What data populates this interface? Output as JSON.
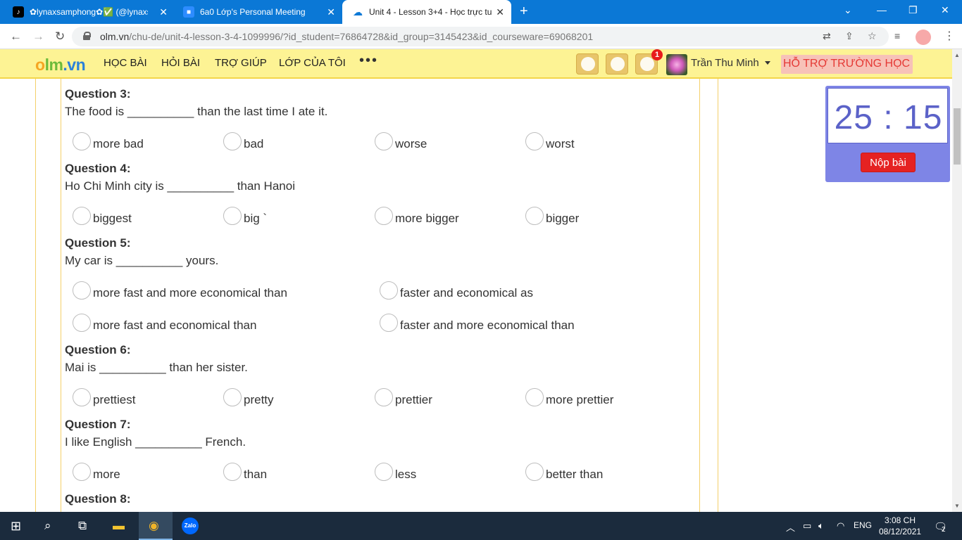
{
  "tabs": [
    {
      "title": "✿lynaxsamphong✿✅ (@lynaxsa",
      "favicon": "tiktok-icon"
    },
    {
      "title": "6a0 Lớp's Personal Meeting R",
      "favicon": "zoom-icon"
    },
    {
      "title": "Unit 4 - Lesson 3+4 - Học trực tu",
      "favicon": "cloud-icon",
      "active": true
    }
  ],
  "url": {
    "host": "olm.vn",
    "path": "/chu-de/unit-4-lesson-3-4-1099996/?id_student=76864728&id_group=3145423&id_courseware=69068201"
  },
  "site": {
    "logo": "olm.vn",
    "menu": [
      "HỌC BÀI",
      "HỎI BÀI",
      "TRỢ GIÚP",
      "LỚP CỦA TÔI"
    ],
    "more": "•••",
    "notification_count": "1",
    "user_name": "Trần Thu Minh",
    "support_label": "HỖ TRỢ TRƯỜNG HỌC"
  },
  "questions": [
    {
      "title": "Question 3:",
      "text": "The food is __________ than the last time I ate it.",
      "options": [
        "more bad",
        "bad",
        "worse",
        "worst"
      ]
    },
    {
      "title": "Question 4:",
      "text": "Ho Chi Minh city is __________ than Hanoi",
      "options": [
        "biggest",
        "big `",
        "more bigger",
        "bigger"
      ]
    },
    {
      "title": "Question 5:",
      "text": "My car is __________ yours.",
      "options": [
        "more fast and more economical than",
        "faster and economical as",
        "more fast and economical than",
        "faster and more economical than"
      ]
    },
    {
      "title": "Question 6:",
      "text": "Mai is __________ than her sister.",
      "options": [
        "prettiest",
        "pretty",
        "prettier",
        "more prettier"
      ]
    },
    {
      "title": "Question 7:",
      "text": "I like English __________ French.",
      "options": [
        "more",
        "than",
        "less",
        "better than"
      ]
    },
    {
      "title": "Question 8:",
      "text": "",
      "options": []
    }
  ],
  "timer": {
    "value": "25 : 15",
    "submit_label": "Nộp bài"
  },
  "taskbar": {
    "lang": "ENG",
    "time": "3:08 CH",
    "date": "08/12/2021",
    "notifications": "2"
  }
}
